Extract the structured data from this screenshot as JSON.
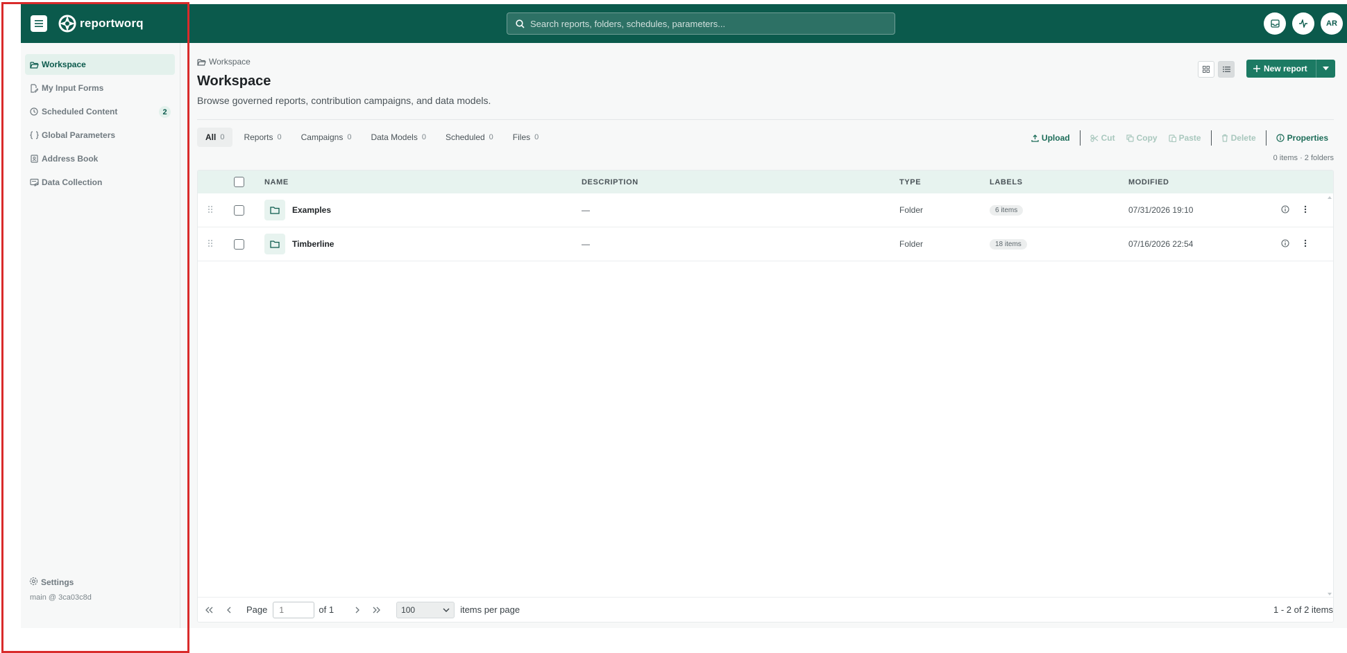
{
  "app": {
    "brand": "reportworq",
    "search_placeholder": "Search reports, folders, schedules, parameters...",
    "user_initials": "AR",
    "colors": {
      "primary": "#0b5a4c",
      "accent": "#1c7a63",
      "active_bg": "#e3f1ec",
      "highlight": "#d92b2b"
    },
    "icons": [
      "menu-icon",
      "logo-icon",
      "search-icon",
      "inbox-icon",
      "activity-icon"
    ]
  },
  "sidebar": {
    "items": [
      {
        "label": "Workspace",
        "icon": "folder-open-icon",
        "active": true
      },
      {
        "label": "My Input Forms",
        "icon": "form-icon"
      },
      {
        "label": "Scheduled Content",
        "icon": "clock-icon",
        "badge": "2"
      },
      {
        "label": "Global Parameters",
        "icon": "braces-icon"
      },
      {
        "label": "Address Book",
        "icon": "address-book-icon"
      },
      {
        "label": "Data Collection",
        "icon": "data-collection-icon"
      }
    ],
    "settings_label": "Settings",
    "version": "main @ 3ca03c8d"
  },
  "main": {
    "breadcrumb": "Workspace",
    "title": "Workspace",
    "subtitle": "Browse governed reports, contribution campaigns, and data models.",
    "new_report_label": "New report",
    "tabs": [
      {
        "label": "All",
        "count": "0",
        "active": true
      },
      {
        "label": "Reports",
        "count": "0"
      },
      {
        "label": "Campaigns",
        "count": "0"
      },
      {
        "label": "Data Models",
        "count": "0"
      },
      {
        "label": "Scheduled",
        "count": "0"
      },
      {
        "label": "Files",
        "count": "0"
      }
    ],
    "actions": {
      "upload": "Upload",
      "cut": "Cut",
      "copy": "Copy",
      "paste": "Paste",
      "delete": "Delete",
      "properties": "Properties"
    },
    "counts": "0 items · 2 folders",
    "table": {
      "headers": {
        "name": "NAME",
        "description": "DESCRIPTION",
        "type": "TYPE",
        "labels": "LABELS",
        "modified": "MODIFIED"
      },
      "rows": [
        {
          "name": "Examples",
          "description": "—",
          "type": "Folder",
          "labels": "6 items",
          "modified": "07/31/2026 19:10"
        },
        {
          "name": "Timberline",
          "description": "—",
          "type": "Folder",
          "labels": "18 items",
          "modified": "07/16/2026 22:54"
        }
      ]
    },
    "pager": {
      "page_label": "Page",
      "page_value": "1",
      "of_label": "of 1",
      "per_page_value": "100",
      "per_page_label": "items per page",
      "range": "1 - 2 of 2 items"
    }
  }
}
